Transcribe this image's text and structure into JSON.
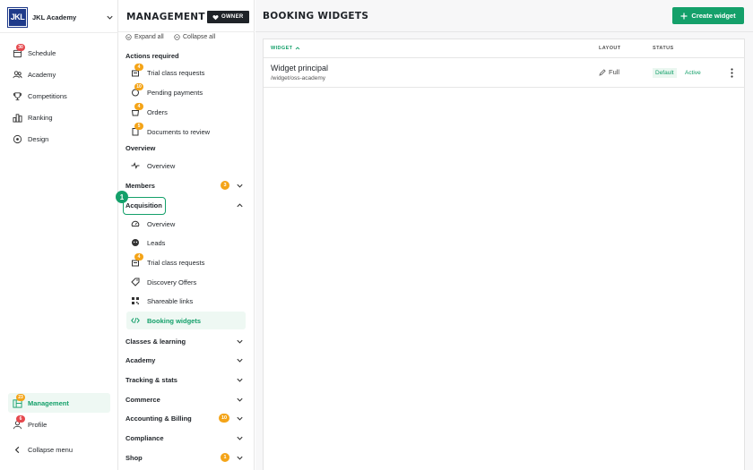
{
  "account": {
    "logo_text": "JKL",
    "name": "JKL Academy"
  },
  "leftnav": {
    "items": [
      {
        "label": "Schedule",
        "icon": "calendar-icon",
        "badge": "30",
        "badge_color": "#e5484d"
      },
      {
        "label": "Academy",
        "icon": "people-icon"
      },
      {
        "label": "Competitions",
        "icon": "trophy-icon"
      },
      {
        "label": "Ranking",
        "icon": "ranking-icon"
      },
      {
        "label": "Design",
        "icon": "palette-icon"
      }
    ],
    "management": {
      "label": "Management",
      "icon": "management-icon",
      "badge": "23",
      "badge_color": "#f4a418"
    },
    "profile": {
      "label": "Profile",
      "icon": "profile-icon",
      "badge": "6",
      "badge_color": "#e5484d"
    },
    "collapse": {
      "label": "Collapse menu",
      "icon": "chevron-left-icon"
    }
  },
  "panel": {
    "title": "MANAGEMENT",
    "owner_label": "OWNER",
    "expand_all": "Expand all",
    "collapse_all": "Collapse all",
    "actions_required": {
      "title": "Actions required",
      "items": [
        {
          "label": "Trial class requests",
          "badge": "4"
        },
        {
          "label": "Pending payments",
          "badge": "10"
        },
        {
          "label": "Orders",
          "badge": "4"
        },
        {
          "label": "Documents to review",
          "badge": "5"
        }
      ]
    },
    "overview_section": {
      "title": "Overview",
      "items": [
        {
          "label": "Overview"
        }
      ]
    },
    "members": {
      "label": "Members",
      "badge": "3"
    },
    "acquisition": {
      "label": "Acquisition",
      "step": "1",
      "items": [
        {
          "label": "Overview"
        },
        {
          "label": "Leads"
        },
        {
          "label": "Trial class requests",
          "badge": "4"
        },
        {
          "label": "Discovery Offers"
        },
        {
          "label": "Shareable links"
        },
        {
          "label": "Booking widgets"
        }
      ]
    },
    "sections": [
      {
        "label": "Classes & learning"
      },
      {
        "label": "Academy"
      },
      {
        "label": "Tracking & stats"
      },
      {
        "label": "Commerce"
      },
      {
        "label": "Accounting & Billing",
        "badge": "10"
      },
      {
        "label": "Compliance"
      },
      {
        "label": "Shop",
        "badge": "1"
      }
    ]
  },
  "main": {
    "title": "BOOKING WIDGETS",
    "create_button": "Create widget",
    "columns": {
      "widget": "WIDGET",
      "layout": "LAYOUT",
      "status": "STATUS"
    },
    "rows": [
      {
        "name": "Widget principal",
        "path": "/widget/oss-academy",
        "layout": "Full",
        "status_default": "Default",
        "status_active": "Active"
      }
    ]
  },
  "colors": {
    "accent": "#14a06a",
    "badge_orange": "#f4a418",
    "badge_red": "#e5484d",
    "owner_bg": "#1f2328"
  }
}
